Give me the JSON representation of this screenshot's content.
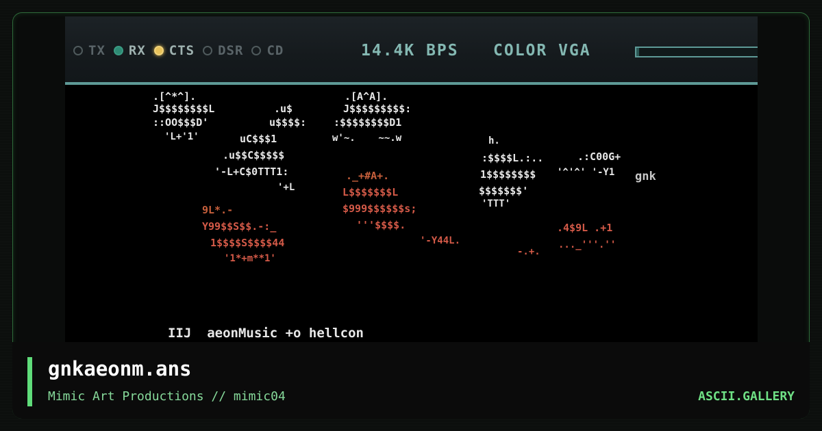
{
  "status_bar": {
    "lights": [
      {
        "label": "TX",
        "state": "off"
      },
      {
        "label": "RX",
        "state": "on",
        "color": "#2e8a74"
      },
      {
        "label": "CTS",
        "state": "on",
        "color": "#e8c25a"
      },
      {
        "label": "DSR",
        "state": "off"
      },
      {
        "label": "CD",
        "state": "off"
      }
    ],
    "baud": "14.4K BPS",
    "mode": "COLOR VGA",
    "progress_fraction": 0.02
  },
  "art": {
    "lines": [
      {
        "text": ".[^*^].",
        "cls": "w"
      },
      {
        "text": "J$$$$$$$$L",
        "cls": "w"
      },
      {
        "text": "::OO$$$D'",
        "cls": "w"
      },
      {
        "text": "'L+'1'",
        "cls": "w"
      },
      {
        "text": ".u$",
        "cls": "w"
      },
      {
        "text": "u$$$$:",
        "cls": "w"
      },
      {
        "text": "uC$$$1",
        "cls": "w"
      },
      {
        "text": ".u$$C$$$$$",
        "cls": "w"
      },
      {
        "text": "'-L+C$0TTT1:",
        "cls": "w"
      },
      {
        "text": "'+L",
        "cls": "w"
      },
      {
        "text": ".[A^A].",
        "cls": "w"
      },
      {
        "text": "J$$$$$$$$$:",
        "cls": "w"
      },
      {
        "text": ":$$$$$$$$D1",
        "cls": "w"
      },
      {
        "text": "w'~.    ~~.w",
        "cls": "w"
      },
      {
        "text": "h.",
        "cls": "w"
      },
      {
        "text": ":$$$$L.:..",
        "cls": "w"
      },
      {
        "text": "1$$$$$$$$",
        "cls": "w"
      },
      {
        "text": "$$$$$$$'",
        "cls": "w"
      },
      {
        "text": "'TTT'",
        "cls": "w"
      },
      {
        "text": ".:C00G+",
        "cls": "w"
      },
      {
        "text": "'^'^' '-Y1",
        "cls": "w"
      },
      {
        "text": "gnk",
        "cls": "g"
      },
      {
        "text": "9L*.-",
        "cls": "o"
      },
      {
        "text": "Y99$$S$$.-:_",
        "cls": "r"
      },
      {
        "text": "1$$$$S$$$$44",
        "cls": "r"
      },
      {
        "text": "'1*+m**1'",
        "cls": "r"
      },
      {
        "text": "._+#A+.",
        "cls": "o"
      },
      {
        "text": "L$$$$$$$L",
        "cls": "r"
      },
      {
        "text": "$999$$$$$$s;",
        "cls": "r"
      },
      {
        "text": "'''$$$$.",
        "cls": "r"
      },
      {
        "text": "'-Y44L.",
        "cls": "r"
      },
      {
        "text": "-.+.",
        "cls": "r"
      },
      {
        "text": ".4$9L .+1",
        "cls": "r"
      },
      {
        "text": "..._'''.''",
        "cls": "r"
      },
      {
        "text": "IIJ  aeonMusic +o hellcon",
        "cls": "w"
      }
    ]
  },
  "footer": {
    "title": "gnkaeonm.ans",
    "subtitle": "Mimic Art Productions // mimic04",
    "brand": "ASCII.GALLERY"
  },
  "colors": {
    "accent": "#5fdc7a",
    "frame_border": "#2e6a3a",
    "status_text": "#84b8b2"
  }
}
